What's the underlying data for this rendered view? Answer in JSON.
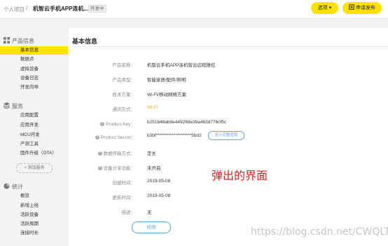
{
  "header": {
    "breadcrumb": "个人项目",
    "separator": "/",
    "project_name": "机智云手机APP连机...",
    "status_badge": "开发中",
    "options_button": "选项 ▾",
    "publish_button": "申请发布"
  },
  "sidebar": {
    "sections": [
      {
        "title": "产品信息",
        "icon": "grid-icon",
        "items": [
          "基本信息",
          "数据点",
          "虚拟设备",
          "设备日志",
          "开发向导"
        ]
      },
      {
        "title": "服务",
        "icon": "stack-icon",
        "items": [
          "应用配置",
          "应用开发",
          "MCU开发",
          "产测工具",
          "固件升级（OTA）"
        ]
      },
      {
        "title": "统计",
        "icon": "pie-chart-icon",
        "items": [
          "概览",
          "新增上线",
          "活跃设备",
          "活跃周期",
          "连接时长"
        ]
      }
    ],
    "active_item": "基本信息",
    "add_service": "+ 添加服务"
  },
  "main": {
    "title": "基本信息",
    "fields": [
      {
        "label": "产品名称：",
        "value": "机智云手机APP连机智云远程操控"
      },
      {
        "label": "产品类型：",
        "value": "智能家居/配件/照明"
      },
      {
        "label": "技术方案：",
        "value": "Wi-Fi/移动网络方案"
      },
      {
        "label": "通讯方式：",
        "value": "Wi-Fi"
      },
      {
        "label": "Product Key：",
        "value": "b251b48ab9e449268e39a463d776cf5c"
      },
      {
        "label": "Product Secret：",
        "value": "b3bf********************5bd2"
      },
      {
        "label": "数据传输方式：",
        "value": "定长"
      },
      {
        "label": "设备分享功能：",
        "value": "未开启"
      },
      {
        "label": "创建时间：",
        "value": "2019-05-08"
      },
      {
        "label": "更新时间：",
        "value": "2019-05-08"
      },
      {
        "label": "描述：",
        "value": "无"
      }
    ],
    "show_secret_button": "显示完整密钥",
    "edit_button": "修改"
  },
  "annotation": "弹出的界面",
  "watermark": "https://blog.csdn.net/CWQLTYH",
  "colors": {
    "accent": "#ffe100",
    "link": "#5aa6e8",
    "annotation": "#e02020"
  }
}
